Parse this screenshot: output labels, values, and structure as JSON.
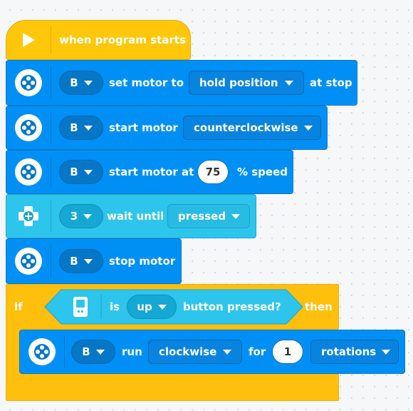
{
  "blocks": {
    "start": {
      "label": "when program starts"
    },
    "set_motor": {
      "port": "B",
      "label": "set motor to",
      "mode": "hold position",
      "suffix": "at stop"
    },
    "start_motor_dir": {
      "port": "B",
      "label": "start motor",
      "direction": "counterclockwise"
    },
    "start_motor_speed": {
      "port": "B",
      "label": "start motor at",
      "speed": "75",
      "suffix": "% speed"
    },
    "wait_until": {
      "port": "3",
      "label": "wait until",
      "state": "pressed"
    },
    "stop_motor": {
      "port": "B",
      "label": "stop motor"
    },
    "if_block": {
      "if_label": "if",
      "is_label": "is",
      "button": "up",
      "cond_label": "button pressed?",
      "then_label": "then"
    },
    "run_motor": {
      "port": "B",
      "label": "run",
      "direction": "clockwise",
      "for_label": "for",
      "amount": "1",
      "unit": "rotations"
    }
  },
  "colors": {
    "motor": "#0090f5",
    "sensor": "#2ec5ec",
    "event": "#ffc70a",
    "background": "#f6f7f9"
  },
  "icons": [
    "play-icon",
    "motor-icon",
    "sensor-icon",
    "hub-icon"
  ]
}
